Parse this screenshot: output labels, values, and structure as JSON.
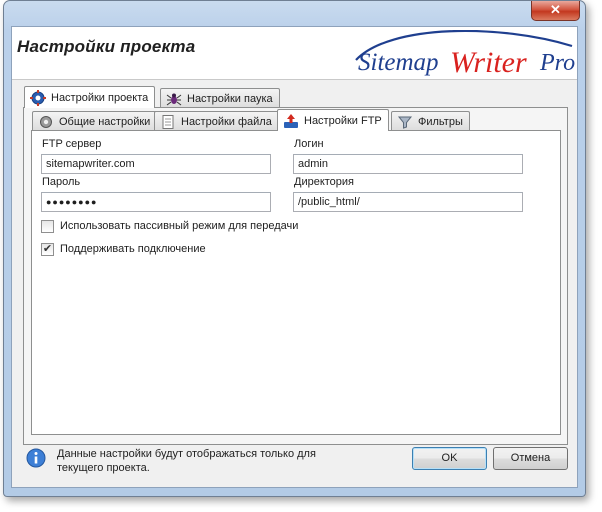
{
  "window": {
    "close_glyph": "✕",
    "title": "Настройки проекта",
    "logo_text": {
      "part1": "Sitemap",
      "part2": "Writer",
      "part3": "Pro"
    },
    "colors": {
      "logo_blue": "#1f3f8f",
      "logo_red": "#d9221f"
    }
  },
  "outer_tabs": [
    {
      "label": "Настройки проекта",
      "icon": "gear-icon",
      "active": true
    },
    {
      "label": "Настройки паука",
      "icon": "spider-icon",
      "active": false
    }
  ],
  "inner_tabs": [
    {
      "label": "Общие настройки",
      "icon": "gear-icon",
      "active": false
    },
    {
      "label": "Настройки файла",
      "icon": "document-icon",
      "active": false
    },
    {
      "label": "Настройки FTP",
      "icon": "ftp-upload-icon",
      "active": true
    },
    {
      "label": "Фильтры",
      "icon": "funnel-icon",
      "active": false
    }
  ],
  "ftp": {
    "server_label": "FTP сервер",
    "server_value": "sitemapwriter.com",
    "login_label": "Логин",
    "login_value": "admin",
    "password_label": "Пароль",
    "password_value": "●●●●●●●●",
    "directory_label": "Директория",
    "directory_value": "/public_html/",
    "passive_mode_label": "Использовать пассивный режим для передачи",
    "passive_mode_checked": false,
    "keepalive_label": "Поддерживать подключение",
    "keepalive_checked": true,
    "check_glyph": "✔"
  },
  "footer": {
    "info_icon": "info-icon",
    "info_text_line1": "Данные настройки будут отображаться только для",
    "info_text_line2": "текущего проекта.",
    "ok_label": "OK",
    "cancel_label": "Отмена"
  }
}
